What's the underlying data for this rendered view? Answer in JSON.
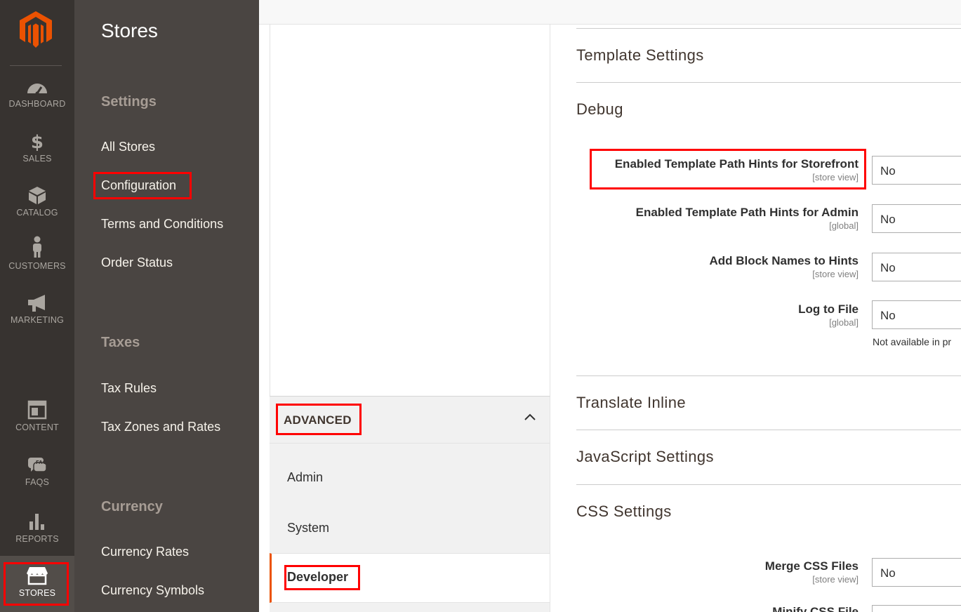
{
  "rail": {
    "items": [
      {
        "label": "DASHBOARD",
        "icon": "dashboard-icon"
      },
      {
        "label": "SALES",
        "icon": "dollar-icon"
      },
      {
        "label": "CATALOG",
        "icon": "box-icon"
      },
      {
        "label": "CUSTOMERS",
        "icon": "person-icon"
      },
      {
        "label": "MARKETING",
        "icon": "megaphone-icon"
      },
      {
        "label": "CONTENT",
        "icon": "layout-icon"
      },
      {
        "label": "FAQS",
        "icon": "faq-icon"
      },
      {
        "label": "REPORTS",
        "icon": "bar-chart-icon"
      },
      {
        "label": "STORES",
        "icon": "store-icon"
      }
    ],
    "accent_color": "#eb5202"
  },
  "flyout": {
    "title": "Stores",
    "settings_heading": "Settings",
    "settings_links": [
      "All Stores",
      "Configuration",
      "Terms and Conditions",
      "Order Status"
    ],
    "taxes_heading": "Taxes",
    "taxes_links": [
      "Tax Rules",
      "Tax Zones and Rates"
    ],
    "currency_heading": "Currency",
    "currency_links": [
      "Currency Rates",
      "Currency Symbols"
    ]
  },
  "tabs": {
    "group": "ADVANCED",
    "items": [
      "Admin",
      "System"
    ],
    "active": "Developer"
  },
  "main": {
    "sections": [
      "Template Settings",
      "Debug",
      "Translate Inline",
      "JavaScript Settings",
      "CSS Settings"
    ],
    "debug_fields": [
      {
        "label": "Enabled Template Path Hints for Storefront",
        "scope": "[store view]",
        "value": "No"
      },
      {
        "label": "Enabled Template Path Hints for Admin",
        "scope": "[global]",
        "value": "No"
      },
      {
        "label": "Add Block Names to Hints",
        "scope": "[store view]",
        "value": "No"
      },
      {
        "label": "Log to File",
        "scope": "[global]",
        "value": "No"
      }
    ],
    "log_note": "Not available in pr",
    "css_fields": [
      {
        "label": "Merge CSS Files",
        "scope": "[store view]",
        "value": "No"
      },
      {
        "label": "Minify CSS File",
        "scope": "",
        "value": ""
      }
    ]
  },
  "highlight_color": "#ff0000"
}
